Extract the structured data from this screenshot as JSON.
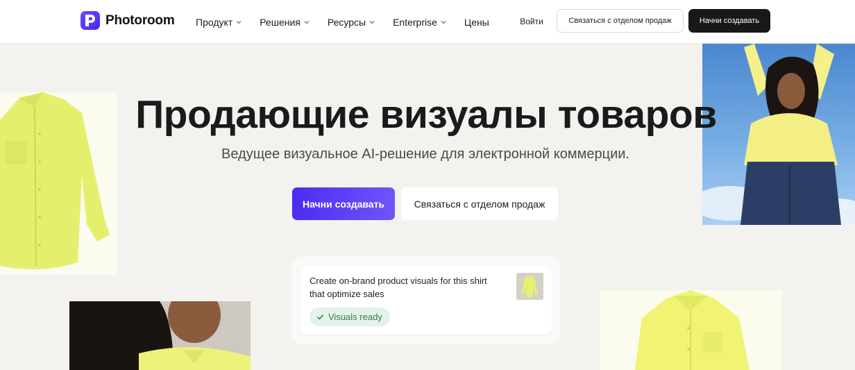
{
  "header": {
    "logo_text": "Photoroom",
    "nav": [
      {
        "label": "Продукт",
        "has_dropdown": true
      },
      {
        "label": "Решения",
        "has_dropdown": true
      },
      {
        "label": "Ресурсы",
        "has_dropdown": true
      },
      {
        "label": "Enterprise",
        "has_dropdown": true
      },
      {
        "label": "Цены",
        "has_dropdown": false
      }
    ],
    "login_label": "Войти",
    "sales_label": "Связаться с отделом продаж",
    "create_label": "Начни создавать"
  },
  "hero": {
    "title": "Продающие визуалы товаров",
    "subtitle": "Ведущее визуальное AI-решение для электронной коммерции.",
    "primary_cta": "Начни создавать",
    "secondary_cta": "Связаться с отделом продаж"
  },
  "prompt_card": {
    "text": "Create on-brand product visuals for this shirt that optimize sales",
    "status": "Visuals ready",
    "status_icon": "check-icon"
  },
  "colors": {
    "brand": "#5b3cf5",
    "page_bg": "#f3f2ef",
    "shirt_yellow": "#e8f37a",
    "success": "#2f7e4b"
  }
}
